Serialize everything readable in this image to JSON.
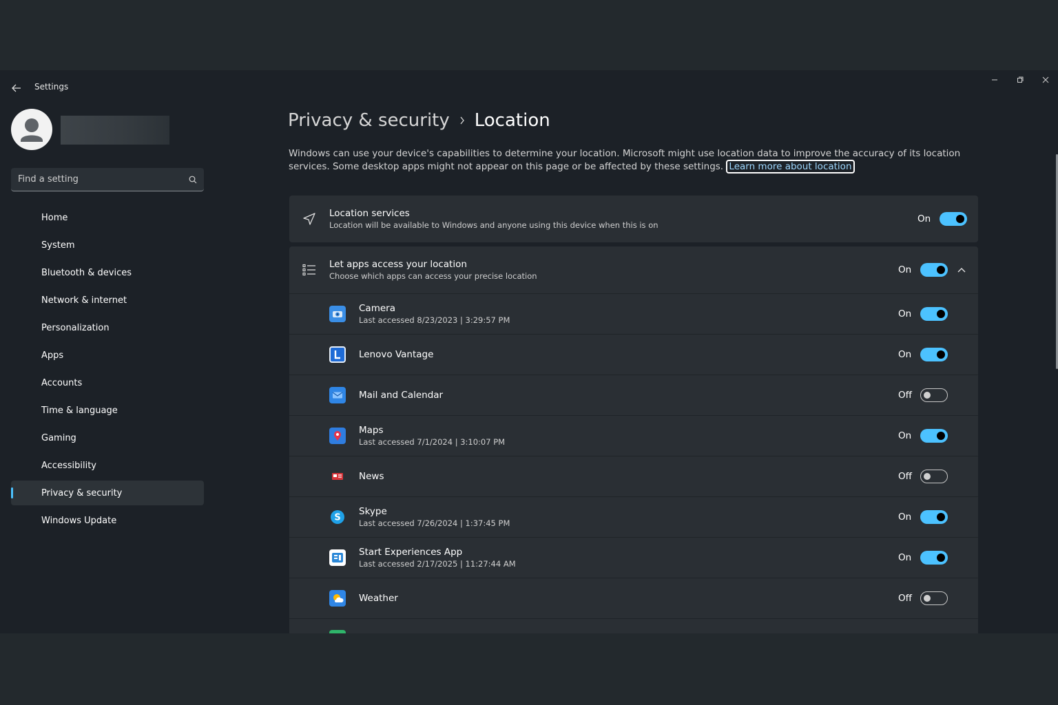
{
  "window": {
    "title": "Settings"
  },
  "sidebar": {
    "search_placeholder": "Find a setting",
    "items": [
      {
        "label": "Home"
      },
      {
        "label": "System"
      },
      {
        "label": "Bluetooth & devices"
      },
      {
        "label": "Network & internet"
      },
      {
        "label": "Personalization"
      },
      {
        "label": "Apps"
      },
      {
        "label": "Accounts"
      },
      {
        "label": "Time & language"
      },
      {
        "label": "Gaming"
      },
      {
        "label": "Accessibility"
      },
      {
        "label": "Privacy & security",
        "active": true
      },
      {
        "label": "Windows Update"
      }
    ]
  },
  "header": {
    "parent": "Privacy & security",
    "current": "Location"
  },
  "description": {
    "text": "Windows can use your device's capabilities to determine your location. Microsoft might use location data to improve the accuracy of its location services. Some desktop apps might not appear on this page or be affected by these settings.",
    "link": "Learn more about location"
  },
  "location_services": {
    "title": "Location services",
    "subtitle": "Location will be available to Windows and anyone using this device when this is on",
    "state": "On",
    "icon": "navigation-arrow-icon"
  },
  "app_access": {
    "title": "Let apps access your location",
    "subtitle": "Choose which apps can access your precise location",
    "state": "On",
    "icon": "list-icon",
    "apps": [
      {
        "name": "Camera",
        "sub": "Last accessed 8/23/2023  |  3:29:57 PM",
        "state": "On",
        "icon": "camera-app-icon",
        "color": "#3a8ee6"
      },
      {
        "name": "Lenovo Vantage",
        "sub": "",
        "state": "On",
        "icon": "lenovo-vantage-icon",
        "color": "#1e6bd6"
      },
      {
        "name": "Mail and Calendar",
        "sub": "",
        "state": "Off",
        "icon": "mail-calendar-icon",
        "color": "#2f86e6"
      },
      {
        "name": "Maps",
        "sub": "Last accessed 7/1/2024  |  3:10:07 PM",
        "state": "On",
        "icon": "maps-icon",
        "color": "#2f7de0"
      },
      {
        "name": "News",
        "sub": "",
        "state": "Off",
        "icon": "news-icon",
        "color": "#d9353a"
      },
      {
        "name": "Skype",
        "sub": "Last accessed 7/26/2024  |  1:37:45 PM",
        "state": "On",
        "icon": "skype-icon",
        "color": "#1fa1e8"
      },
      {
        "name": "Start Experiences App",
        "sub": "Last accessed 2/17/2025  |  11:27:44 AM",
        "state": "On",
        "icon": "start-experiences-icon",
        "color": "#2b88d8"
      },
      {
        "name": "Weather",
        "sub": "",
        "state": "Off",
        "icon": "weather-icon",
        "color": "#2f86e6"
      }
    ]
  },
  "colors": {
    "accent": "#4cc2ff",
    "window_bg": "#1c2127",
    "card_bg": "#2a2f34"
  }
}
